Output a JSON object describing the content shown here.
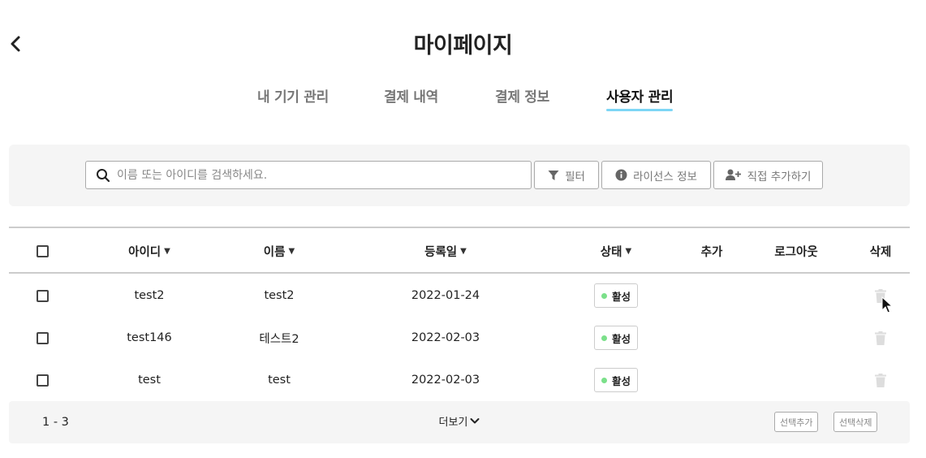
{
  "page": {
    "title": "마이페이지"
  },
  "tabs": [
    {
      "label": "내 기기 관리",
      "active": false
    },
    {
      "label": "결제 내역",
      "active": false
    },
    {
      "label": "결제 정보",
      "active": false
    },
    {
      "label": "사용자 관리",
      "active": true
    }
  ],
  "toolbar": {
    "search_placeholder": "이름 또는 아이디를 검색하세요.",
    "filter_label": "필터",
    "license_label": "라이선스 정보",
    "add_user_label": "직접 추가하기"
  },
  "table": {
    "columns": {
      "id": "아이디",
      "name": "이름",
      "registered": "등록일",
      "status": "상태",
      "add": "추가",
      "logout": "로그아웃",
      "delete": "삭제"
    },
    "rows": [
      {
        "id": "test2",
        "name": "test2",
        "registered": "2022-01-24",
        "status": "활성"
      },
      {
        "id": "test146",
        "name": "테스트2",
        "registered": "2022-02-03",
        "status": "활성"
      },
      {
        "id": "test",
        "name": "test",
        "registered": "2022-02-03",
        "status": "활성"
      }
    ]
  },
  "footer": {
    "range": "1 - 3",
    "more_label": "더보기",
    "select_add_label": "선택추가",
    "select_delete_label": "선택삭제"
  },
  "colors": {
    "tab_underline": "#7dd6f5",
    "status_active": "#7be08a",
    "panel_bg": "#f5f5f5"
  },
  "icons": {
    "back": "chevron-left-icon",
    "search": "search-icon",
    "filter": "filter-icon",
    "license": "info-circle-icon",
    "add_user": "user-plus-icon",
    "sort": "caret-down-icon",
    "delete": "trash-icon",
    "more": "chevron-down-icon"
  }
}
